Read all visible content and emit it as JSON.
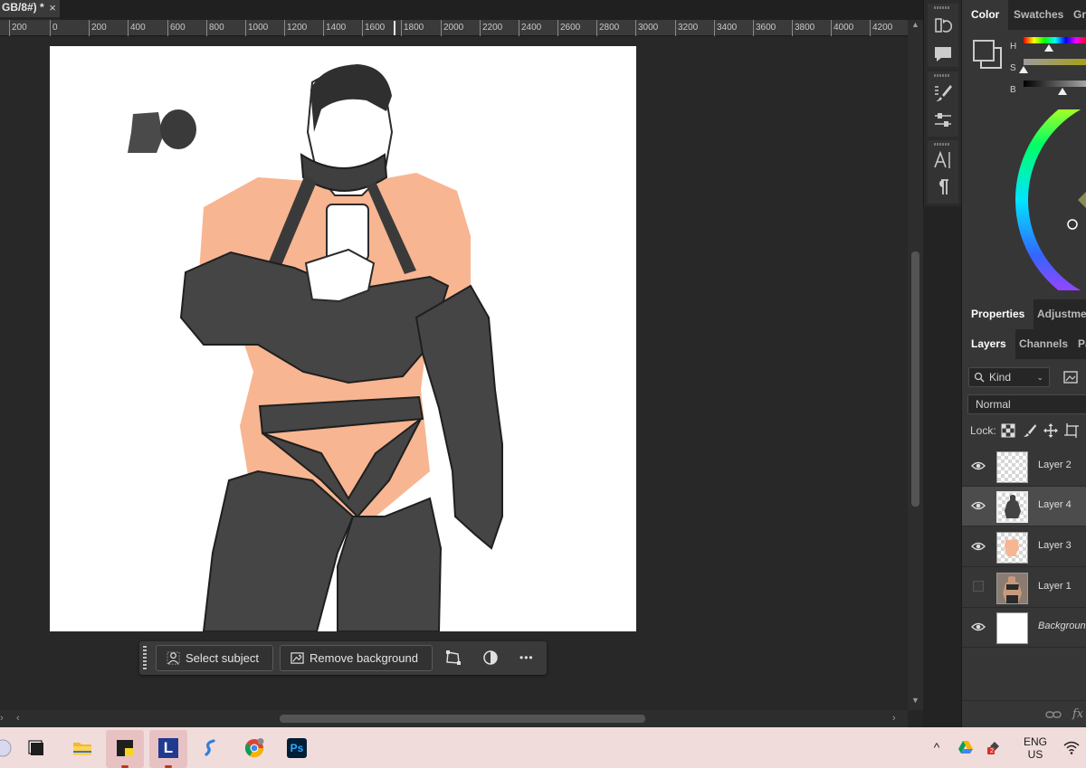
{
  "document": {
    "tab_title": "GB/8#) *",
    "close_glyph": "×"
  },
  "ruler": {
    "ticks": [
      "200",
      "0",
      "200",
      "400",
      "600",
      "800",
      "1000",
      "1200",
      "1400",
      "1600",
      "1800",
      "2000",
      "2200",
      "2400",
      "2600",
      "2800",
      "3000",
      "3200",
      "3400",
      "3600",
      "3800",
      "4000",
      "4200"
    ]
  },
  "context_taskbar": {
    "select_subject_label": "Select subject",
    "remove_background_label": "Remove background",
    "transform_icon": "transform-icon",
    "adjust_icon": "adjustment-icon",
    "more_label": "•••"
  },
  "color_panel": {
    "tabs": [
      "Color",
      "Swatches",
      "Gr"
    ],
    "labels": [
      "H",
      "S",
      "B"
    ],
    "hue_level_percent": 40,
    "saturation_level_percent": 0,
    "brightness_level_percent": 61
  },
  "properties_tabs": [
    "Properties",
    "Adjustmen"
  ],
  "layers_tabs": [
    "Layers",
    "Channels",
    "Pa"
  ],
  "layers_panel": {
    "kind_label": "Kind",
    "blend_mode": "Normal",
    "lock_label": "Lock:",
    "layers": [
      {
        "name": "Layer 2",
        "visible": true,
        "selected": false,
        "italic": false
      },
      {
        "name": "Layer 4",
        "visible": true,
        "selected": true,
        "italic": false
      },
      {
        "name": "Layer 3",
        "visible": true,
        "selected": false,
        "italic": false
      },
      {
        "name": "Layer 1",
        "visible": false,
        "selected": false,
        "italic": false
      },
      {
        "name": "Background",
        "visible": true,
        "selected": false,
        "italic": true
      }
    ],
    "fx_label": "fx"
  },
  "windows_taskbar": {
    "apps": [
      "task-view",
      "file-explorer",
      "sticky-notes",
      "lightshot",
      "simplenote",
      "chrome",
      "photoshop"
    ],
    "photoshop_label": "Ps",
    "l_label": "L",
    "lang_line1": "ENG",
    "lang_line2": "US",
    "badge_count": "2"
  },
  "colors": {
    "accent_photoshop": "#31a8ff",
    "skin": "#f8b591",
    "garment": "#454545"
  }
}
